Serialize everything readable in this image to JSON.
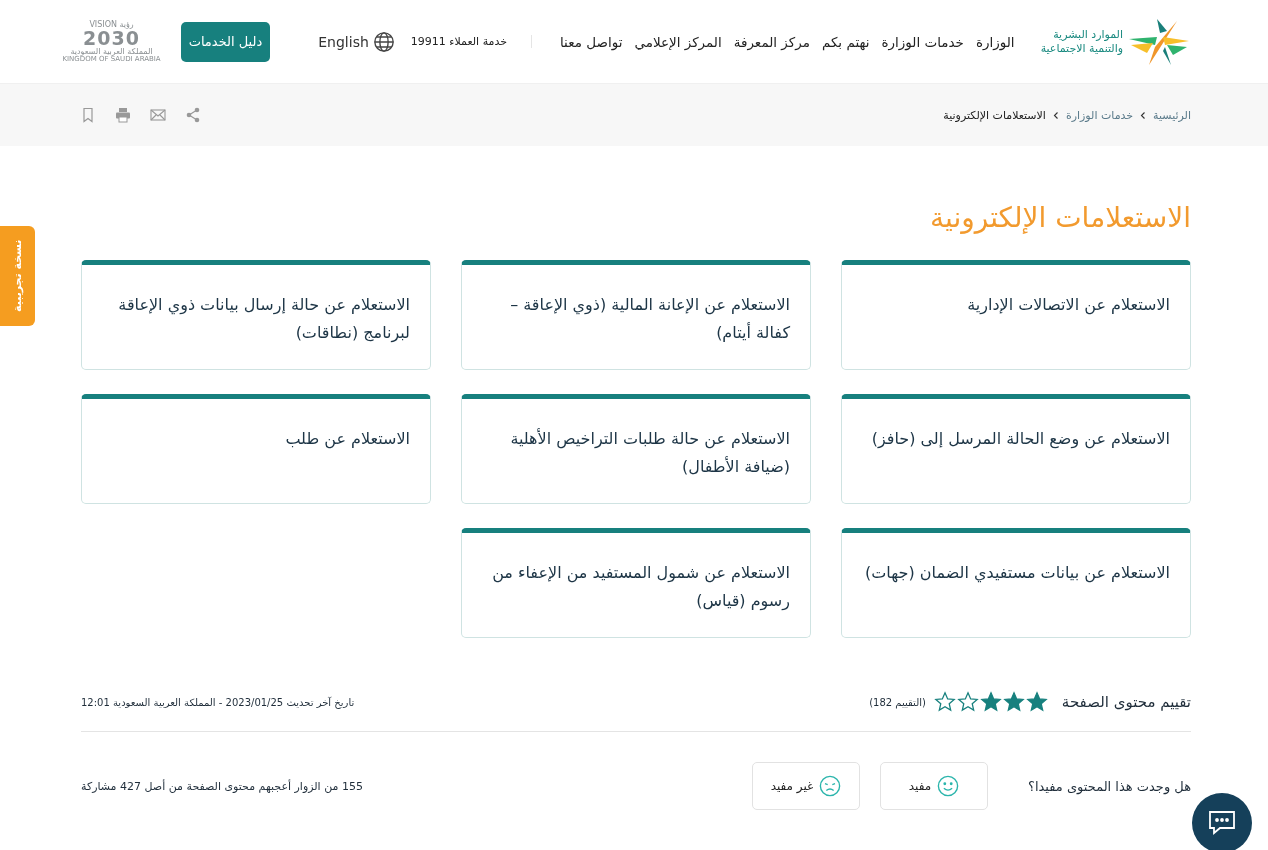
{
  "header": {
    "logo_lines": [
      "الموارد البشرية",
      "والتنمية الاجتماعية"
    ],
    "nav": [
      "الوزارة",
      "خدمات الوزارة",
      "نهتم بكم",
      "مركز المعرفة",
      "المركز الإعلامي",
      "تواصل معنا"
    ],
    "hotline": "خدمة العملاء 19911",
    "language": "English",
    "guide_button": "دليل الخدمات",
    "vision": {
      "top": "VISION رؤية",
      "year": "2030",
      "ar": "المملكة العربية السعودية",
      "en": "KINGDOM OF SAUDI ARABIA"
    }
  },
  "breadcrumb": [
    {
      "label": "الرئيسية",
      "current": false
    },
    {
      "label": "خدمات الوزارة",
      "current": false
    },
    {
      "label": "الاستعلامات الإلكترونية",
      "current": true
    }
  ],
  "beta_tab": "نسخة تجريبية",
  "title": "الاستعلامات الإلكترونية",
  "cards": [
    {
      "title": "الاستعلام عن الاتصالات الإدارية"
    },
    {
      "title": "الاستعلام عن الإعانة المالية (ذوي الإعاقة – كفالة أيتام)"
    },
    {
      "title": "الاستعلام عن حالة إرسال بيانات ذوي الإعاقة لبرنامج (نطاقات)"
    },
    {
      "title": "الاستعلام عن وضع الحالة المرسل إلى (حافز)"
    },
    {
      "title": "الاستعلام عن حالة طلبات التراخيص الأهلية (ضيافة الأطفال)"
    },
    {
      "title": "الاستعلام عن طلب"
    },
    {
      "title": "الاستعلام عن بيانات مستفيدي الضمان (جهات)"
    },
    {
      "title": "الاستعلام عن شمول المستفيد من الإعفاء من رسوم (قياس)"
    }
  ],
  "rating": {
    "label": "تقييم محتوى الصفحة",
    "stars": 3,
    "count": "(التقييم 182)"
  },
  "updated": "تاريخ آخر تحديث  2023/01/25  - المملكة العربية السعودية  12:01",
  "feedback": {
    "question": "هل وجدت هذا المحتوى مفيدا؟",
    "useful": "مفيد",
    "not_useful": "غير مفيد",
    "summary": "155 من الزوار أعجبهم محتوى الصفحة من أصل 427 مشاركة"
  }
}
